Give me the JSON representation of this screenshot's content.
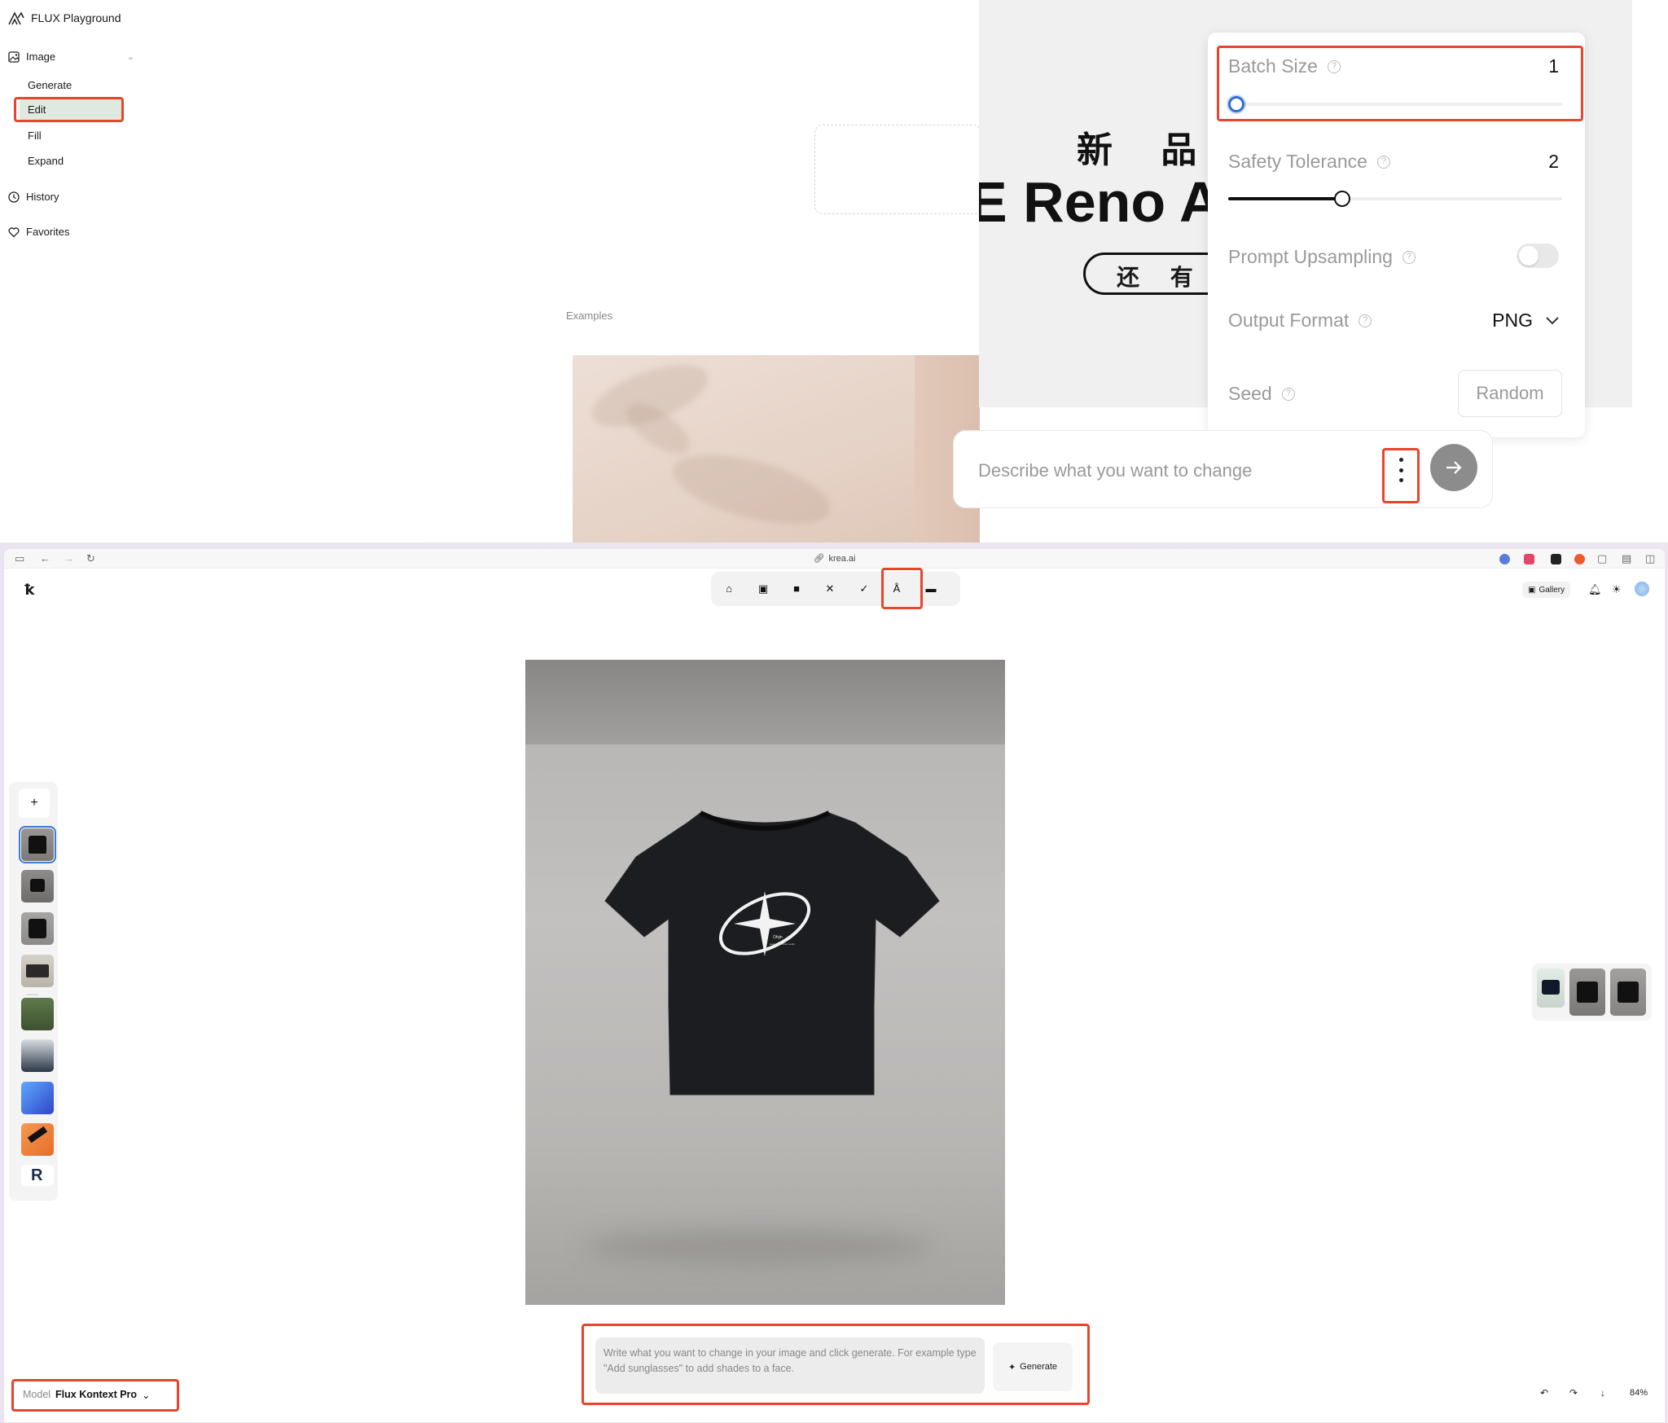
{
  "flux": {
    "brand": "FLUX Playground",
    "nav": {
      "image": "Image",
      "items": [
        "Generate",
        "Edit",
        "Fill",
        "Expand"
      ],
      "history": "History",
      "favorites": "Favorites"
    },
    "examples_label": "Examples",
    "preview_text": {
      "cn_line": "新 品 王",
      "reno": "E Reno Ac",
      "cn_pill": "还 有"
    },
    "settings": {
      "batch_size": {
        "label": "Batch Size",
        "value": "1"
      },
      "safety_tolerance": {
        "label": "Safety Tolerance",
        "value": "2"
      },
      "prompt_upsampling": {
        "label": "Prompt Upsampling",
        "enabled": false
      },
      "output_format": {
        "label": "Output Format",
        "value": "PNG"
      },
      "seed": {
        "label": "Seed",
        "button": "Random"
      }
    },
    "prompt_placeholder": "Describe what you want to change"
  },
  "krea": {
    "url": "krea.ai",
    "gallery": "Gallery",
    "zoom": "84%",
    "prompt_placeholder": "Write what you want to change in your image and click generate. For example type \"Add sunglasses\" to add shades to a face.",
    "generate": "Generate",
    "model_label": "Model",
    "model_value": "Flux Kontext Pro",
    "tshirt_print_1": "Ohjin",
    "tshirt_print_2": "design collective studio"
  },
  "colors": {
    "highlight_red": "#e8452e",
    "active_nav": "#dfe9df",
    "slider_blue": "#2f6fcf"
  }
}
